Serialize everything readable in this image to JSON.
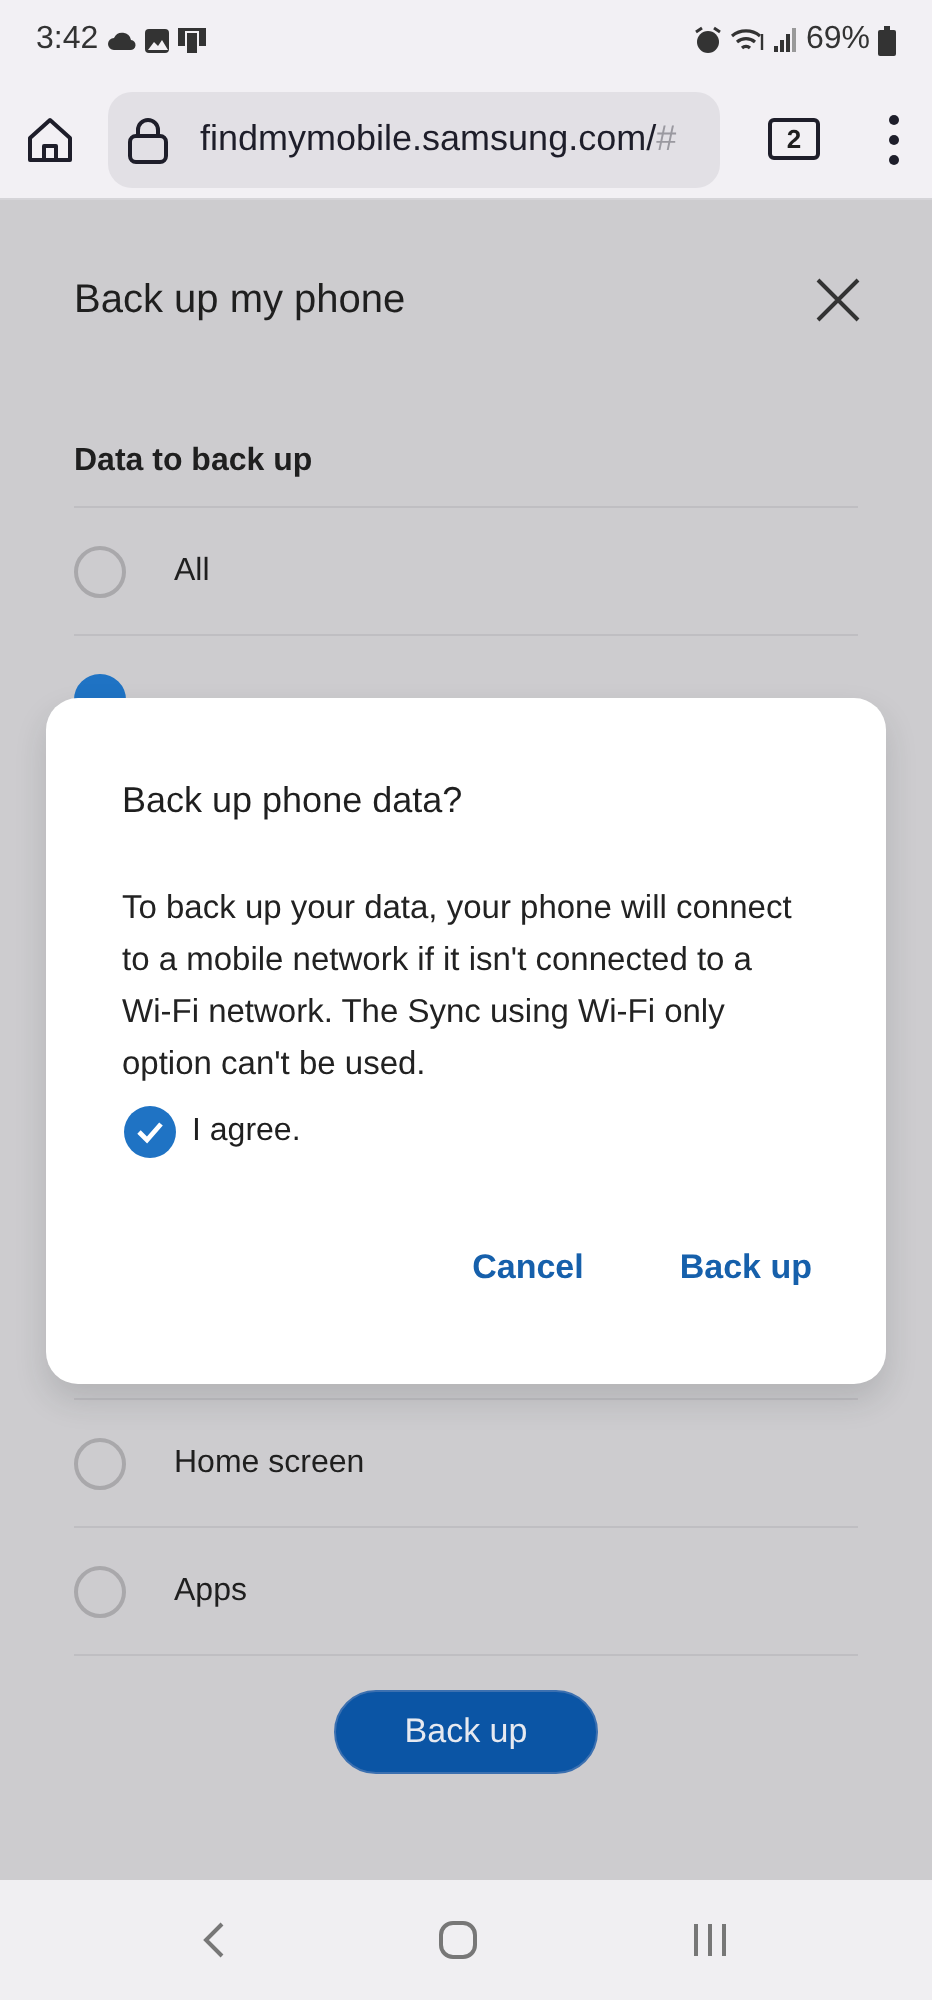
{
  "status_bar": {
    "time": "3:42",
    "battery": "69%"
  },
  "browser": {
    "url": "findmymobile.samsung.com/",
    "url_tail": "#",
    "tab_count": "2"
  },
  "sheet": {
    "title": "Back up my phone",
    "section": "Data to back up",
    "options_top": [
      {
        "label": "All",
        "checked": false
      },
      {
        "checked": true
      }
    ],
    "options_bottom": [
      {
        "label": "Home screen",
        "checked": false
      },
      {
        "label": "Apps",
        "checked": false
      }
    ],
    "button": "Back up"
  },
  "dialog": {
    "title": "Back up phone data?",
    "message": "To back up your data, your phone will connect to a mobile network if it isn't connected to a Wi-Fi network. The Sync using Wi-Fi only option can't be used.",
    "agree": {
      "label": "I agree.",
      "checked": true
    },
    "buttons": [
      "Cancel",
      "Back up"
    ]
  }
}
